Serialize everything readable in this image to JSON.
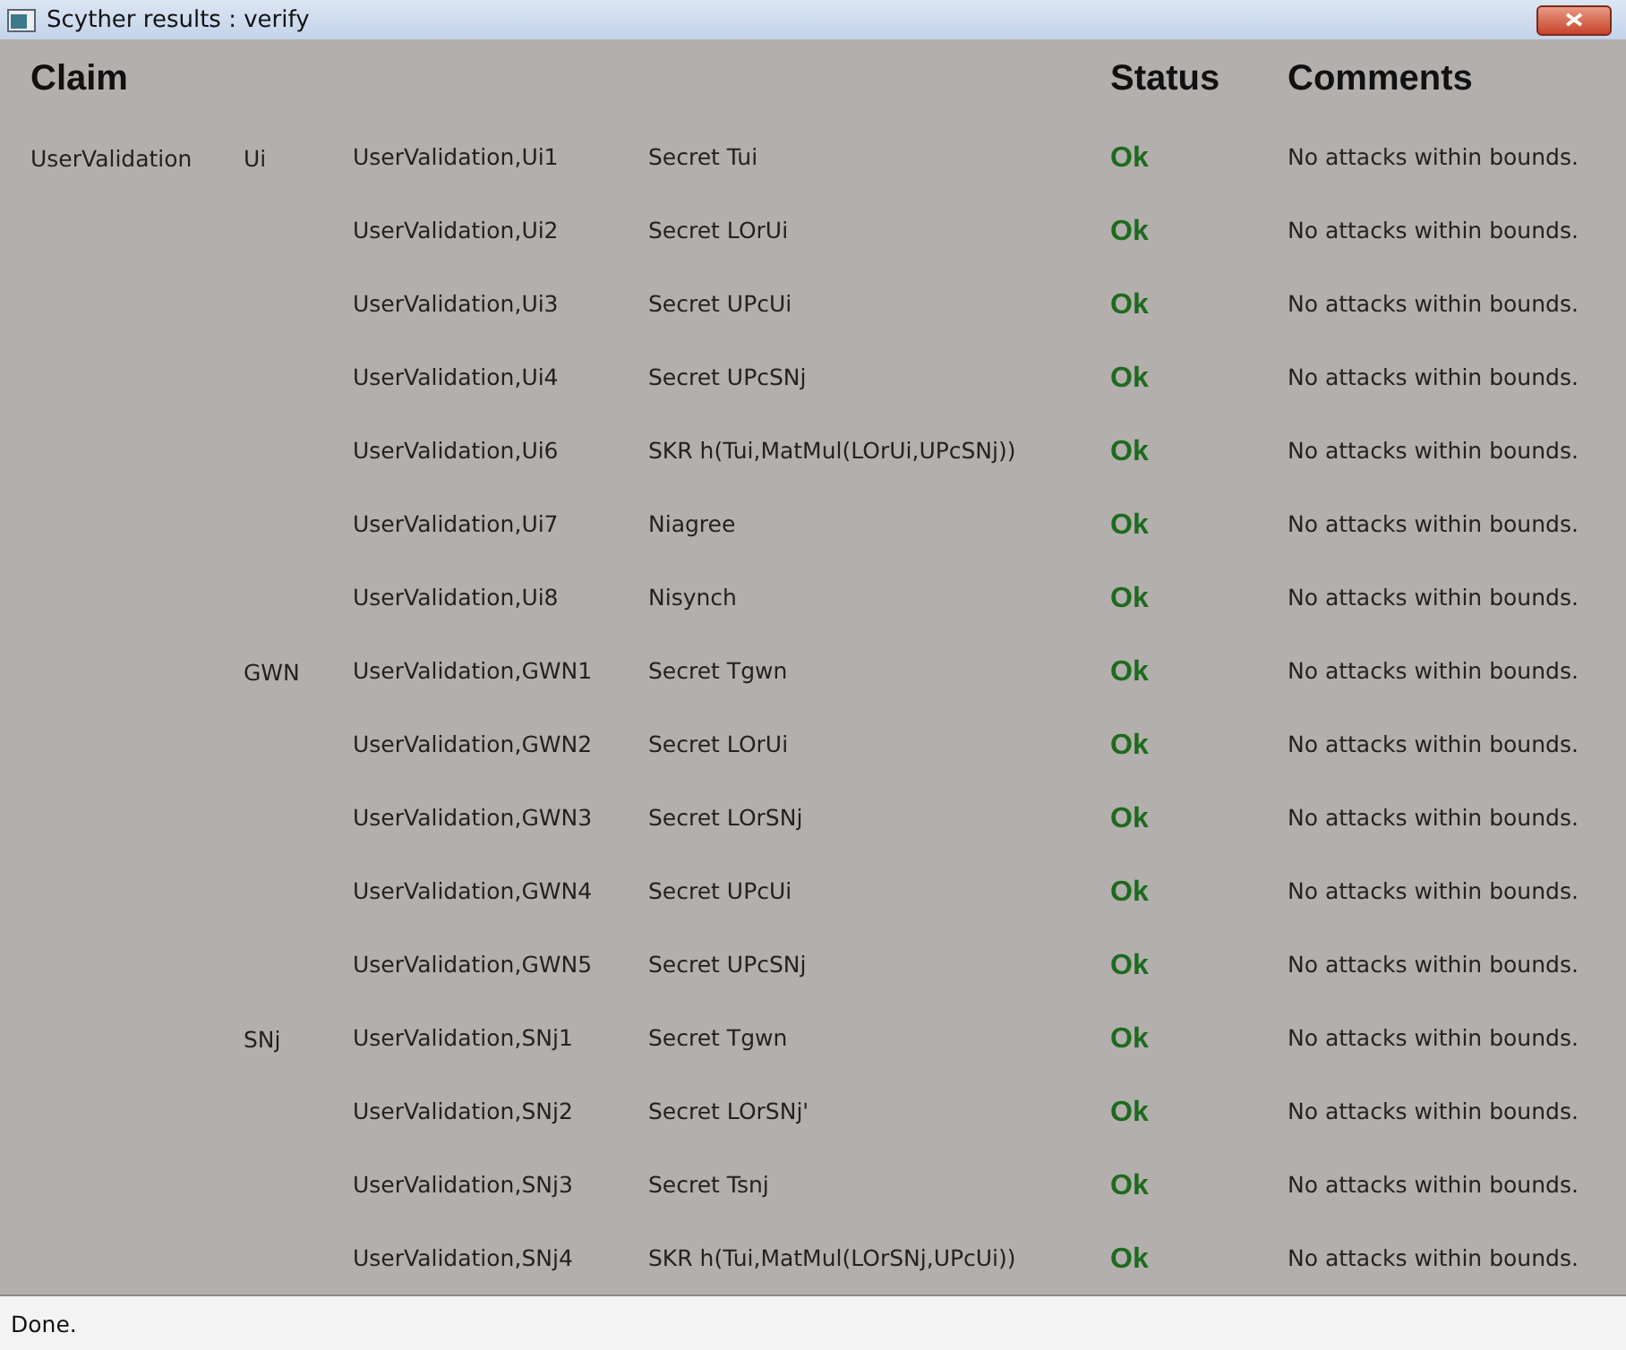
{
  "window": {
    "title": "Scyther results : verify"
  },
  "headers": {
    "claim": "Claim",
    "status": "Status",
    "comments": "Comments"
  },
  "rows": [
    {
      "protocol": "UserValidation",
      "role": "Ui",
      "id": "UserValidation,Ui1",
      "claim": "Secret Tui",
      "status": "Ok",
      "comment": "No attacks within bounds."
    },
    {
      "id": "UserValidation,Ui2",
      "claim": "Secret LOrUi",
      "status": "Ok",
      "comment": "No attacks within bounds."
    },
    {
      "id": "UserValidation,Ui3",
      "claim": "Secret UPcUi",
      "status": "Ok",
      "comment": "No attacks within bounds."
    },
    {
      "id": "UserValidation,Ui4",
      "claim": "Secret UPcSNj",
      "status": "Ok",
      "comment": "No attacks within bounds."
    },
    {
      "id": "UserValidation,Ui6",
      "claim": "SKR h(Tui,MatMul(LOrUi,UPcSNj))",
      "status": "Ok",
      "comment": "No attacks within bounds."
    },
    {
      "id": "UserValidation,Ui7",
      "claim": "Niagree",
      "status": "Ok",
      "comment": "No attacks within bounds."
    },
    {
      "id": "UserValidation,Ui8",
      "claim": "Nisynch",
      "status": "Ok",
      "comment": "No attacks within bounds."
    },
    {
      "role": "GWN",
      "id": "UserValidation,GWN1",
      "claim": "Secret Tgwn",
      "status": "Ok",
      "comment": "No attacks within bounds."
    },
    {
      "id": "UserValidation,GWN2",
      "claim": "Secret LOrUi",
      "status": "Ok",
      "comment": "No attacks within bounds."
    },
    {
      "id": "UserValidation,GWN3",
      "claim": "Secret LOrSNj",
      "status": "Ok",
      "comment": "No attacks within bounds."
    },
    {
      "id": "UserValidation,GWN4",
      "claim": "Secret UPcUi",
      "status": "Ok",
      "comment": "No attacks within bounds."
    },
    {
      "id": "UserValidation,GWN5",
      "claim": "Secret UPcSNj",
      "status": "Ok",
      "comment": "No attacks within bounds."
    },
    {
      "role": "SNj",
      "id": "UserValidation,SNj1",
      "claim": "Secret Tgwn",
      "status": "Ok",
      "comment": "No attacks within bounds."
    },
    {
      "id": "UserValidation,SNj2",
      "claim": "Secret LOrSNj'",
      "status": "Ok",
      "comment": "No attacks within bounds."
    },
    {
      "id": "UserValidation,SNj3",
      "claim": "Secret Tsnj",
      "status": "Ok",
      "comment": "No attacks within bounds."
    },
    {
      "id": "UserValidation,SNj4",
      "claim": "SKR h(Tui,MatMul(LOrSNj,UPcUi))",
      "status": "Ok",
      "comment": "No attacks within bounds."
    }
  ],
  "status_bar": "Done."
}
